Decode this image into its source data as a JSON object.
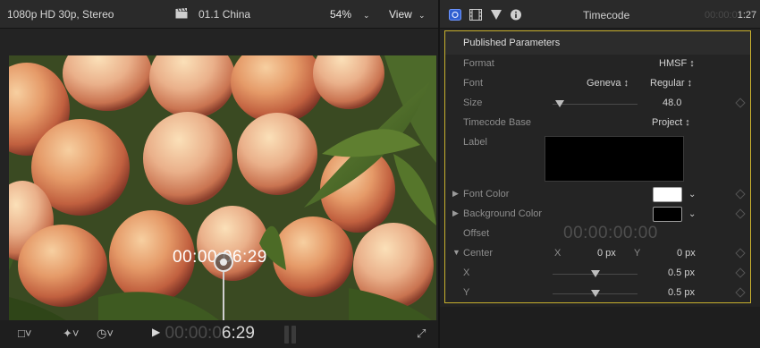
{
  "viewer": {
    "format_info": "1080p HD 30p, Stereo",
    "clip_name": "01.1 China",
    "zoom": "54%",
    "view_menu": "View",
    "overlay_timecode": "00:00:06:29",
    "playhead_timecode_dim": "00:00:0",
    "playhead_timecode_lit": "6:29"
  },
  "inspector": {
    "title": "Timecode",
    "timecode_dim": "00:00:0",
    "timecode_lit": "1:27",
    "section_title": "Published Parameters",
    "params": {
      "format": {
        "label": "Format",
        "value": "HMSF ↕"
      },
      "font": {
        "label": "Font",
        "family": "Geneva ↕",
        "style": "Regular ↕"
      },
      "size": {
        "label": "Size",
        "value": "48.0",
        "level": 0.08
      },
      "timecode_base": {
        "label": "Timecode Base",
        "value": "Project ↕"
      },
      "label": {
        "label": "Label"
      },
      "font_color": {
        "label": "Font Color",
        "color": "#ffffff"
      },
      "background_color": {
        "label": "Background Color",
        "color": "#000000"
      },
      "offset": {
        "label": "Offset",
        "value": "00:00:00:00"
      },
      "center": {
        "label": "Center",
        "x_axis": "X",
        "y_axis": "Y",
        "x_value": "0 px",
        "y_value": "0 px"
      },
      "x": {
        "label": "X",
        "value": "0.5 px",
        "level": 0.5
      },
      "y": {
        "label": "Y",
        "value": "0.5 px",
        "level": 0.5
      }
    }
  },
  "colors": {
    "highlight_border": "#c8b12e",
    "panel_bg": "#232323"
  }
}
